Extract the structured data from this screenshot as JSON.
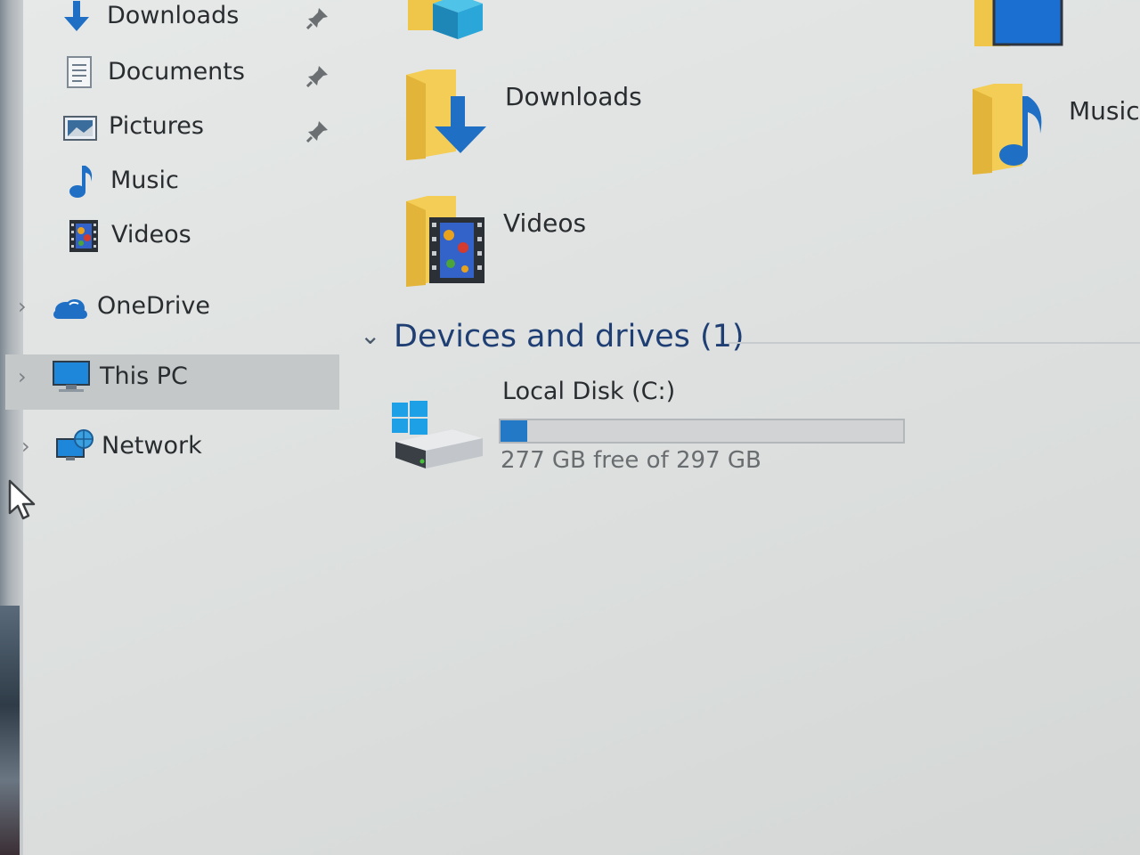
{
  "nav": {
    "quick_access": [
      {
        "label": "Downloads",
        "icon": "downloads-icon",
        "pinned": true
      },
      {
        "label": "Documents",
        "icon": "documents-icon",
        "pinned": true
      },
      {
        "label": "Pictures",
        "icon": "pictures-icon",
        "pinned": true
      },
      {
        "label": "Music",
        "icon": "music-icon",
        "pinned": false
      },
      {
        "label": "Videos",
        "icon": "videos-icon",
        "pinned": false
      }
    ],
    "roots": [
      {
        "label": "OneDrive",
        "icon": "onedrive-icon",
        "selected": false
      },
      {
        "label": "This PC",
        "icon": "this-pc-icon",
        "selected": true
      },
      {
        "label": "Network",
        "icon": "network-icon",
        "selected": false
      }
    ]
  },
  "folders": {
    "downloads_label": "Downloads",
    "videos_label": "Videos",
    "music_label": "Music"
  },
  "devices": {
    "section_title": "Devices and drives (1)",
    "drive": {
      "name": "Local Disk (C:)",
      "free_text": "277 GB free of 297 GB",
      "used_fraction": 0.067
    }
  },
  "colors": {
    "accent": "#2479c7",
    "section_title": "#1f3f74",
    "selected_bg": "#c5c8c9",
    "folder_yellow": "#f0c64a"
  }
}
